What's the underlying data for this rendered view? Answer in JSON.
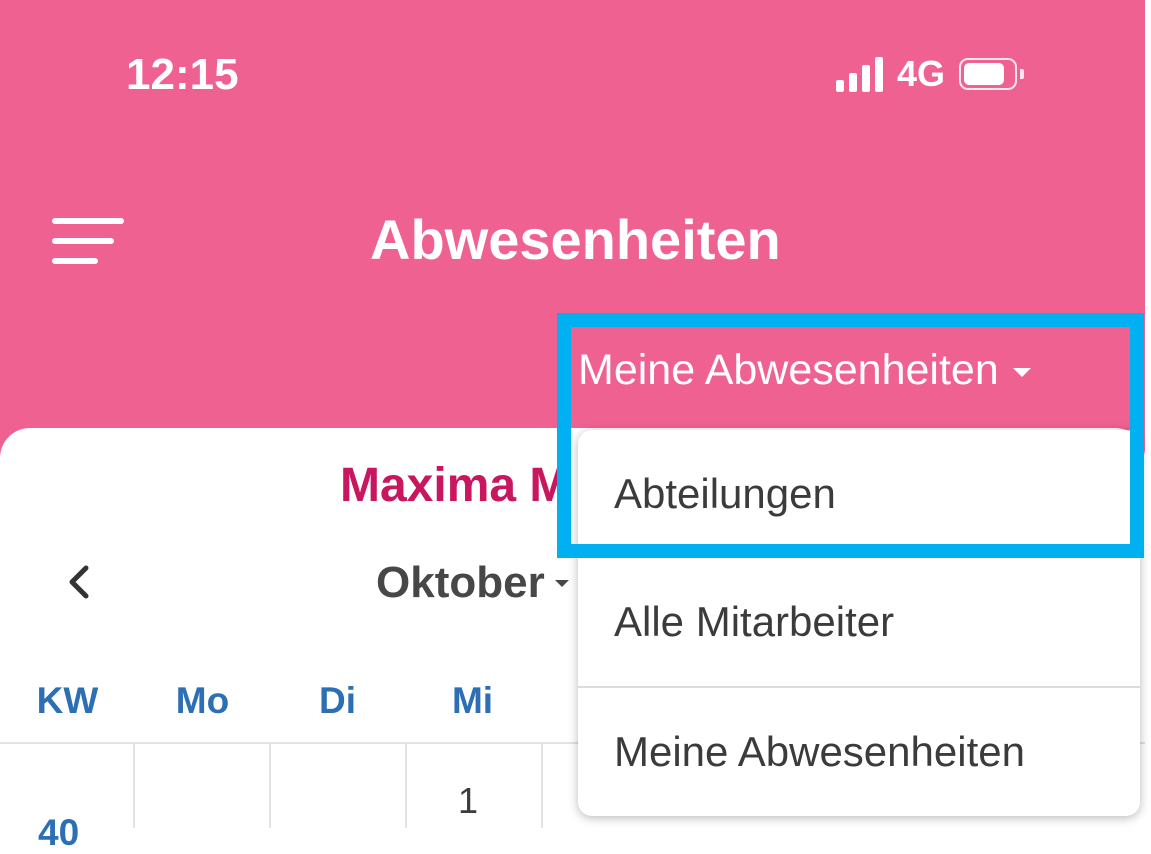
{
  "status_bar": {
    "time": "12:15",
    "network": "4G"
  },
  "header": {
    "title": "Abwesenheiten",
    "filter_label": "Meine Abwesenheiten"
  },
  "calendar": {
    "user_name": "Maxima M",
    "month": "Oktober",
    "weekdays": [
      "KW",
      "Mo",
      "Di",
      "Mi"
    ],
    "week_number": "40",
    "first_day": "1"
  },
  "dropdown": {
    "items": [
      {
        "label": "Abteilungen"
      },
      {
        "label": "Alle Mitarbeiter"
      },
      {
        "label": "Meine Abwesenheiten"
      }
    ]
  },
  "colors": {
    "header_bg": "#ef6190",
    "accent_name": "#c8165f",
    "weekday_blue": "#2c6fb5",
    "highlight": "#00b0f0"
  }
}
